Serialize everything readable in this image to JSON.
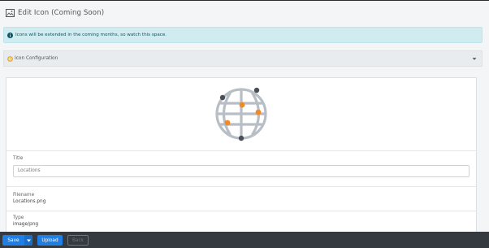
{
  "page": {
    "title": "Edit Icon (Coming Soon)"
  },
  "alert": {
    "text": "Icons will be extended in the coming months, so watch this space."
  },
  "config": {
    "header": "Icon Configuration"
  },
  "form": {
    "title_label": "Title",
    "title_value": "Locations",
    "filename_label": "Filename",
    "filename_value": "Locations.png",
    "type_label": "Type",
    "type_value": "image/png"
  },
  "toolbar": {
    "save_label": "Save",
    "upload_label": "Upload",
    "back_label": "Back"
  },
  "colors": {
    "accent": "#1f7fe5",
    "info_bg": "#d1ecf1",
    "info_text": "#0c5460",
    "bar_bg": "#343a40",
    "globe_lines": "#b8bec6",
    "dot_orange": "#f08a24",
    "dot_dark": "#4a4f57"
  },
  "icons": {
    "page_title": "image-icon",
    "alert": "info-circle-icon",
    "config": "settings-circle-icon",
    "caret": "caret-down-icon",
    "preview": "globe-network-icon"
  }
}
